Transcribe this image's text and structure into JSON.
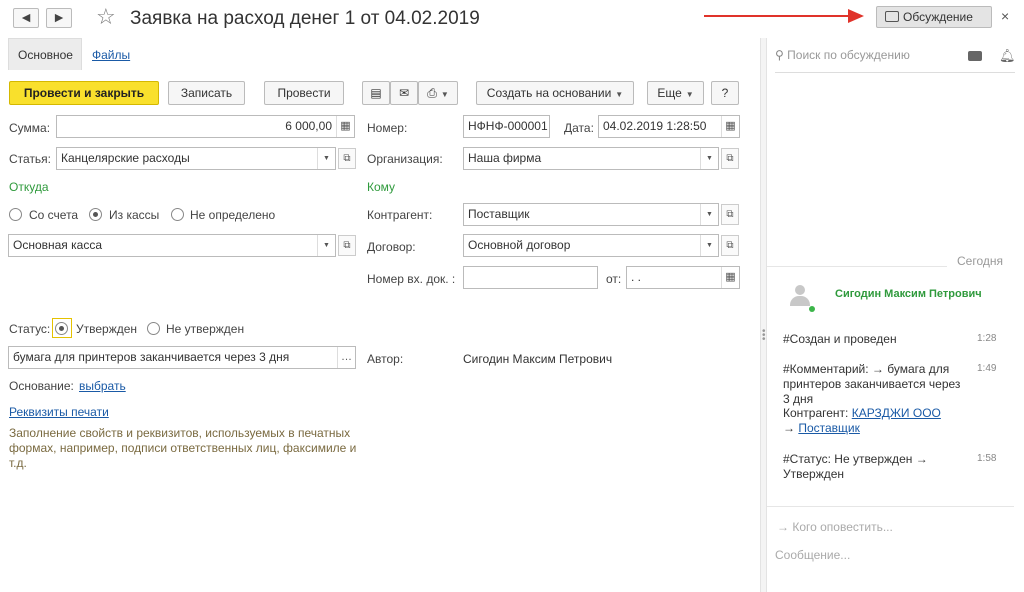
{
  "window": {
    "title": "Заявка на расход денег 1 от 04.02.2019",
    "back": "◄",
    "forward": "►",
    "discussion_button": "Обсуждение",
    "close": "×"
  },
  "tabs": {
    "main": "Основное",
    "files": "Файлы"
  },
  "toolbar": {
    "post_close": "Провести и закрыть",
    "save": "Записать",
    "post": "Провести",
    "create_based": "Создать на основании",
    "more": "Еще",
    "help": "?"
  },
  "form": {
    "sum_label": "Сумма:",
    "sum_value": "6 000,00",
    "article_label": "Статья:",
    "article_value": "Канцелярские расходы",
    "from_header": "Откуда",
    "radio_account": "Со счета",
    "radio_cash": "Из кассы",
    "radio_undefined": "Не определено",
    "cashbox_value": "Основная касса",
    "number_label": "Номер:",
    "number_value": "НФНФ-000001",
    "date_label": "Дата:",
    "date_value": "04.02.2019  1:28:50",
    "org_label": "Организация:",
    "org_value": "Наша фирма",
    "to_header": "Кому",
    "counterparty_label": "Контрагент:",
    "counterparty_value": "Поставщик",
    "contract_label": "Договор:",
    "contract_value": "Основной договор",
    "incoming_label": "Номер вх. док. :",
    "incoming_value": "",
    "from_label": "от:",
    "from_value": ".    .",
    "status_label": "Статус:",
    "status_approved": "Утвержден",
    "status_not_approved": "Не утвержден",
    "comment_value": "бумага для принтеров заканчивается через 3 дня",
    "author_label": "Автор:",
    "author_value": "Сигодин Максим Петрович",
    "basis_label": "Основание:",
    "basis_link": "выбрать",
    "print_link": "Реквизиты печати",
    "print_note": "Заполнение свойств и реквизитов, используемых в печатных формах, например, подписи ответственных лиц, факсимиле и т.д."
  },
  "discussion": {
    "search_placeholder": "Поиск по обсуждению",
    "today": "Сегодня",
    "user_name": "Сигодин Максим Петрович",
    "messages": [
      {
        "text": "#Создан и проведен",
        "time": "1:28"
      },
      {
        "text": "#Комментарий:  → бумага для принтеров заканчивается через 3 дня",
        "counterparty_label": "Контрагент:",
        "counterparty_link": "КАРЗДЖИ ООО",
        "arrow": "→",
        "target_link": "Поставщик",
        "time": "1:49"
      },
      {
        "text": "#Статус: Не утвержден → Утвержден",
        "time": "1:58"
      }
    ],
    "notify_placeholder": "Кого оповестить...",
    "message_placeholder": "Сообщение..."
  },
  "colors": {
    "primary": "#f9e02c",
    "green": "#2f9a3c",
    "link": "#1a5aa6",
    "arrow": "#e0332a"
  }
}
